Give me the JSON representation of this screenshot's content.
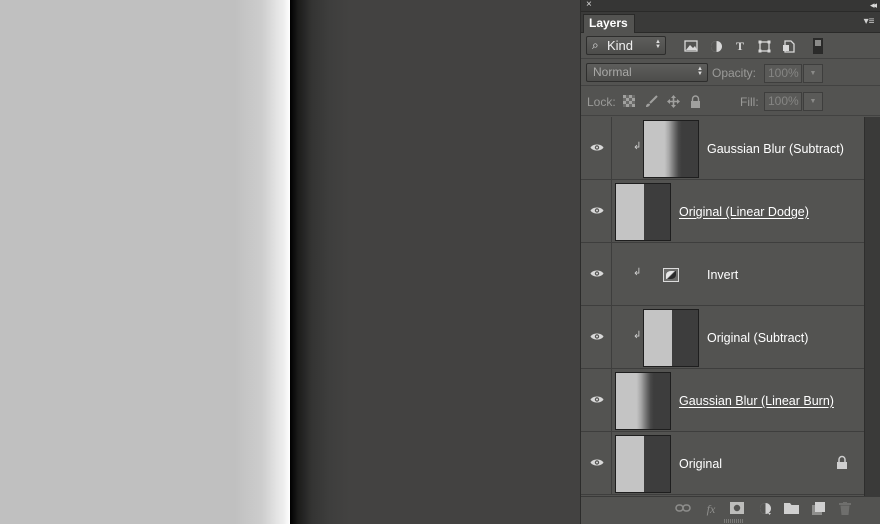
{
  "panel": {
    "close_glyph": "×",
    "collapse_glyph": "◂◂",
    "tab_title": "Layers",
    "menu_glyph": "▾≡"
  },
  "filter": {
    "kind_label": "Kind",
    "kind_icon": "magnifier-icon",
    "filter_icons": [
      "pixel-layer-filter-icon",
      "adjustment-layer-filter-icon",
      "type-layer-filter-icon",
      "shape-layer-filter-icon",
      "smart-object-filter-icon"
    ]
  },
  "blend": {
    "mode": "Normal",
    "opacity_label": "Opacity:",
    "opacity_value": "100%",
    "lock_label": "Lock:",
    "fill_label": "Fill:",
    "fill_value": "100%"
  },
  "layers": [
    {
      "name": "Gaussian Blur (Subtract)",
      "clipped": true,
      "thumb": "blur",
      "has_effects": false,
      "locked": false,
      "visible": true
    },
    {
      "name": "Original (Linear Dodge)",
      "clipped": false,
      "thumb": "split",
      "has_effects": true,
      "locked": false,
      "visible": true
    },
    {
      "name": "Invert",
      "clipped": true,
      "thumb": "adjustment",
      "has_effects": false,
      "locked": false,
      "visible": true
    },
    {
      "name": "Original (Subtract)",
      "clipped": true,
      "thumb": "split",
      "has_effects": false,
      "locked": false,
      "visible": true
    },
    {
      "name": "Gaussian Blur (Linear Burn)",
      "clipped": false,
      "thumb": "blur",
      "has_effects": true,
      "locked": false,
      "visible": true
    },
    {
      "name": "Original",
      "clipped": false,
      "thumb": "split",
      "has_effects": false,
      "locked": true,
      "visible": true
    }
  ],
  "bottom_icons": [
    "link-layers-icon",
    "fx-icon",
    "add-mask-icon",
    "new-adjustment-icon",
    "new-group-icon",
    "new-layer-icon",
    "delete-layer-icon"
  ],
  "colors": {
    "panel_bg": "#535351",
    "canvas_light": "#c0c0c0",
    "canvas_dark": "#434241"
  }
}
